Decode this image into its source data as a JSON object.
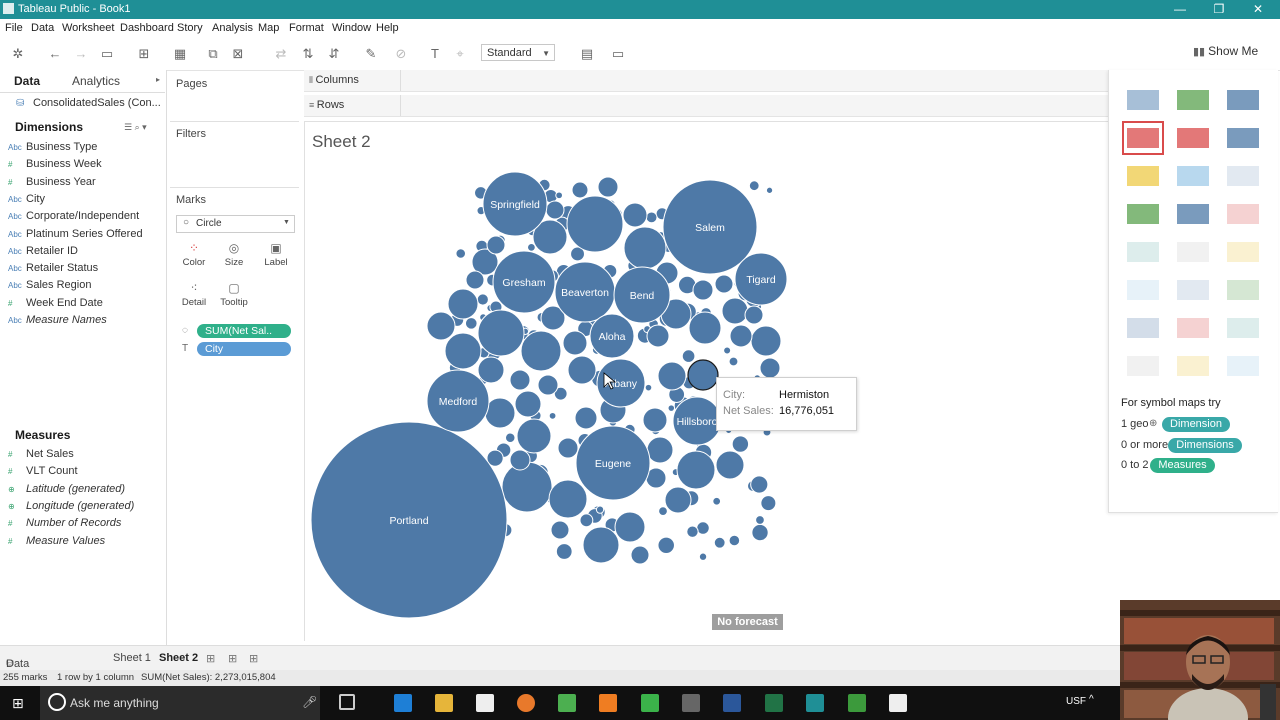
{
  "window": {
    "title": "Tableau Public - Book1"
  },
  "menu": [
    "File",
    "Data",
    "Worksheet",
    "Dashboard",
    "Story",
    "Analysis",
    "Map",
    "Format",
    "Window",
    "Help"
  ],
  "toolbar": {
    "fit": "Standard",
    "show_me": "Show Me"
  },
  "data_pane": {
    "tab_data": "Data",
    "tab_analytics": "Analytics",
    "source": "ConsolidatedSales (Con...",
    "dimensions_header": "Dimensions",
    "dimensions": [
      {
        "label": "Business Type",
        "icon": "Abc"
      },
      {
        "label": "Business Week",
        "icon": "#"
      },
      {
        "label": "Business Year",
        "icon": "#"
      },
      {
        "label": "City",
        "icon": "Abc"
      },
      {
        "label": "Corporate/Independent",
        "icon": "Abc"
      },
      {
        "label": "Platinum Series Offered",
        "icon": "Abc"
      },
      {
        "label": "Retailer ID",
        "icon": "Abc"
      },
      {
        "label": "Retailer Status",
        "icon": "Abc"
      },
      {
        "label": "Sales Region",
        "icon": "Abc"
      },
      {
        "label": "Week End Date",
        "icon": "#"
      },
      {
        "label": "Measure Names",
        "icon": "Abc"
      }
    ],
    "measures_header": "Measures",
    "measures": [
      {
        "label": "Net Sales",
        "icon": "#"
      },
      {
        "label": "VLT Count",
        "icon": "#"
      },
      {
        "label": "Latitude (generated)",
        "icon": "⊕"
      },
      {
        "label": "Longitude (generated)",
        "icon": "⊕"
      },
      {
        "label": "Number of Records",
        "icon": "#"
      },
      {
        "label": "Measure Values",
        "icon": "#"
      }
    ]
  },
  "shelves": {
    "pages": "Pages",
    "filters": "Filters",
    "marks": "Marks",
    "mark_type": "Circle",
    "mark_buttons": [
      "Color",
      "Size",
      "Label",
      "Detail",
      "Tooltip"
    ],
    "pill_size": "SUM(Net Sal..",
    "pill_label": "City",
    "columns": "Columns",
    "rows": "Rows"
  },
  "sheet": {
    "title": "Sheet 2"
  },
  "chart_data": {
    "type": "packed-bubble",
    "measure": "Net Sales",
    "dimension": "City",
    "labeled_bubbles": [
      "Portland",
      "Salem",
      "Eugene",
      "Medford",
      "Springfield",
      "Gresham",
      "Beaverton",
      "Bend",
      "Aloha",
      "Albany",
      "Hillsboro",
      "Tigard"
    ],
    "tooltip": {
      "City": "Hermiston",
      "Net Sales": "16,776,051"
    }
  },
  "tooltip": {
    "city_key": "City:",
    "city_val": "Hermiston",
    "sales_key": "Net Sales:",
    "sales_val": "16,776,051"
  },
  "no_forecast": "No forecast",
  "show_me": {
    "hint_title": "For symbol maps try",
    "line1_prefix": "1 geo",
    "line1_pill": "Dimension",
    "line2_prefix": "0 or more",
    "line2_pill": "Dimensions",
    "line3_prefix": "0 to 2",
    "line3_pill": "Measures",
    "accent": "#39a8a8"
  },
  "tabs": {
    "data_source": "Data Source",
    "sheet1": "Sheet 1",
    "sheet2": "Sheet 2"
  },
  "status": {
    "marks": "255 marks",
    "rows": "1 row by 1 column",
    "sum": "SUM(Net Sales): 2,273,015,804"
  },
  "taskbar": {
    "search": "Ask me anything",
    "lang": "USF"
  },
  "colors": {
    "bubble": "#4e79a7",
    "titlebar": "#1f8f96",
    "pill_green": "#2fb08a",
    "pill_blue": "#5b9bd5"
  }
}
